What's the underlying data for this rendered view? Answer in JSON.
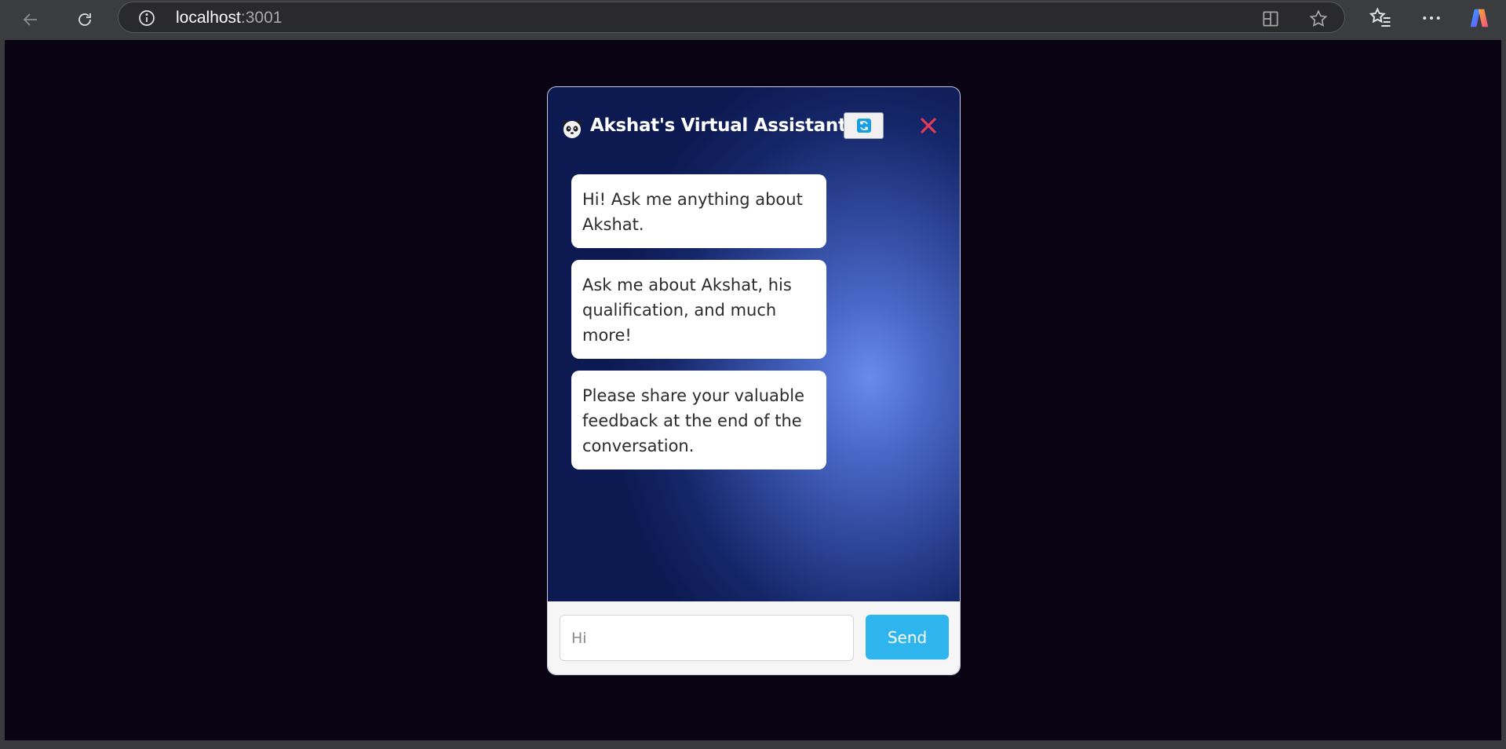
{
  "browser": {
    "url_host": "localhost",
    "url_port": ":3001",
    "icons": [
      "back-icon",
      "refresh-icon",
      "site-info-icon",
      "split-screen-icon",
      "favorite-star-icon",
      "favorites-icon",
      "more-icon",
      "copilot-icon"
    ]
  },
  "chat": {
    "title": "Akshat's Virtual Assistant",
    "messages": [
      "Hi! Ask me anything about Akshat.",
      "Ask me about Akshat, his qualification, and much more!",
      "Please share your valuable feedback at the end of the conversation."
    ],
    "input_placeholder": "Hi",
    "send_label": "Send",
    "colors": {
      "send_button": "#2fb5ee",
      "close_icon": "#e33a5b",
      "refresh_icon": "#1b9ee0"
    }
  }
}
